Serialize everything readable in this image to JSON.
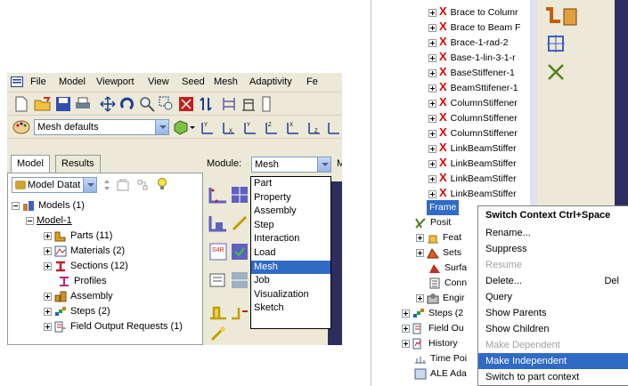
{
  "menubar": {
    "items": [
      {
        "label": "File"
      },
      {
        "label": "Model"
      },
      {
        "label": "Viewport"
      },
      {
        "label": "View"
      },
      {
        "label": "Seed"
      },
      {
        "label": "Mesh"
      },
      {
        "label": "Adaptivity"
      },
      {
        "label": "Fe"
      }
    ]
  },
  "toolbar2": {
    "mesh_defaults": "Mesh defaults"
  },
  "tabs": {
    "model": "Model",
    "results": "Results"
  },
  "model_db_combo": "Model Datat",
  "module": {
    "label": "Module:",
    "value": "Mesh",
    "next_label": "M"
  },
  "module_options": [
    "Part",
    "Property",
    "Assembly",
    "Step",
    "Interaction",
    "Load",
    "Mesh",
    "Job",
    "Visualization",
    "Sketch"
  ],
  "module_selected": "Mesh",
  "tree": {
    "models": "Models (1)",
    "model1": "Model-1",
    "parts": "Parts (11)",
    "materials": "Materials (2)",
    "sections": "Sections (12)",
    "profiles": "Profiles",
    "assembly": "Assembly",
    "steps": "Steps (2)",
    "field_output": "Field Output Requests (1)"
  },
  "right_tree": {
    "items": [
      "Brace to Columr",
      "Brace to Beam F",
      "Brace-1-rad-2",
      "Base-1-lin-3-1-r",
      "BaseStiffener-1",
      "BeamSttifener-1",
      "ColumnStiffener",
      "ColumnStiffener",
      "ColumnStiffener",
      "LinkBeamStiffer",
      "LinkBeamStiffer",
      "LinkBeamStiffer",
      "LinkBeamStiffer"
    ],
    "frame": "Frame",
    "lower": [
      "Posit",
      "Feat",
      "Sets",
      "Surfa",
      "Conn",
      "Engir",
      "Steps (2",
      "Field Ou",
      "History",
      "Time Poi",
      "ALE Ada"
    ]
  },
  "context_menu": {
    "switch_context": "Switch Context",
    "switch_shortcut": "Ctrl+Space",
    "rename": "Rename...",
    "suppress": "Suppress",
    "resume": "Resume",
    "delete": "Delete...",
    "delete_shortcut": "Del",
    "query": "Query",
    "show_parents": "Show Parents",
    "show_children": "Show Children",
    "make_dependent": "Make Dependent",
    "make_independent": "Make Independent",
    "switch_to_part": "Switch to part context"
  },
  "colors": {
    "selection": "#316ac5",
    "window_bg": "#ece9d8",
    "viewport": "#2e2e5e",
    "error_x": "#e00000"
  }
}
